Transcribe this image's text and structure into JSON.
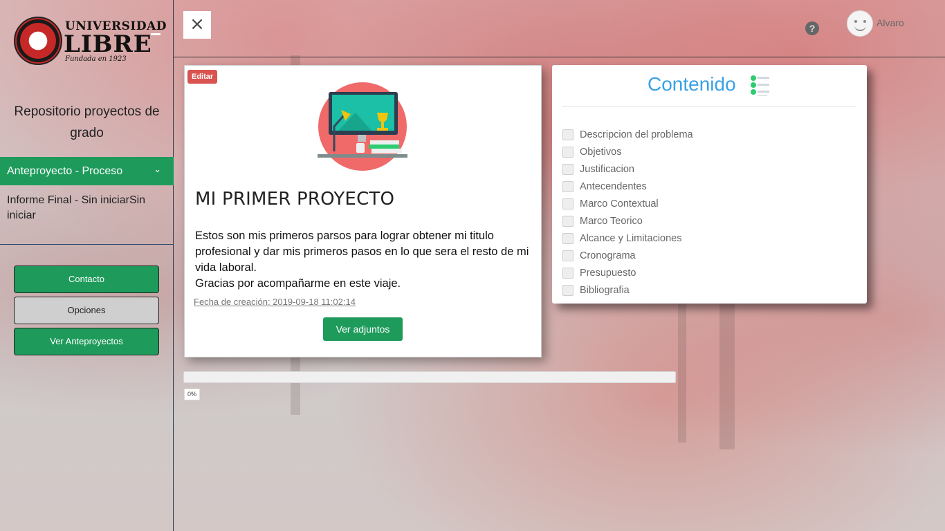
{
  "app": {
    "logo": {
      "top_text": "UNIVERSIDAD",
      "main_text": "LIBRE",
      "sub_text": "Fundada en 1923"
    }
  },
  "sidebar": {
    "title": "Repositorio proyectos de grado",
    "active_item": "Anteproyecto - Proceso",
    "items": [
      {
        "label": "Informe Final - Sin iniciarSin iniciar"
      }
    ],
    "buttons": [
      {
        "label": "Contacto",
        "style": "green"
      },
      {
        "label": "Opciones",
        "style": "grey"
      },
      {
        "label": "Ver Anteproyectos",
        "style": "green"
      }
    ]
  },
  "header": {
    "close_icon": "×",
    "help_icon": "?",
    "user_name": "Alvaro"
  },
  "project": {
    "edit_label": "Editar",
    "title": "MI PRIMER PROYECTO",
    "description_lines": [
      "Estos son mis primeros parsos para lograr obtener mi titulo profesional y dar mis primeros pasos en lo que sera el resto de mi vida laboral.",
      "Gracias por acompañarme en este viaje."
    ],
    "created_label": "Fecha de creación: 2019-09-18 11:02:14",
    "attachments_button": "Ver adjuntos"
  },
  "content": {
    "title": "Contenido",
    "items": [
      {
        "label": "Descripcion del problema",
        "checked": false
      },
      {
        "label": "Objetivos",
        "checked": false
      },
      {
        "label": "Justificacion",
        "checked": false
      },
      {
        "label": "Antecendentes",
        "checked": false
      },
      {
        "label": "Marco Contextual",
        "checked": false
      },
      {
        "label": "Marco Teorico",
        "checked": false
      },
      {
        "label": "Alcance y Limitaciones",
        "checked": false
      },
      {
        "label": "Cronograma",
        "checked": false
      },
      {
        "label": "Presupuesto",
        "checked": false
      },
      {
        "label": "Bibliografia",
        "checked": false
      }
    ]
  },
  "progress": {
    "percent": 0,
    "label": "0%"
  },
  "colors": {
    "primary_green": "#1e9b5b",
    "edit_red": "#d9534f",
    "content_blue": "#39a1e6"
  }
}
